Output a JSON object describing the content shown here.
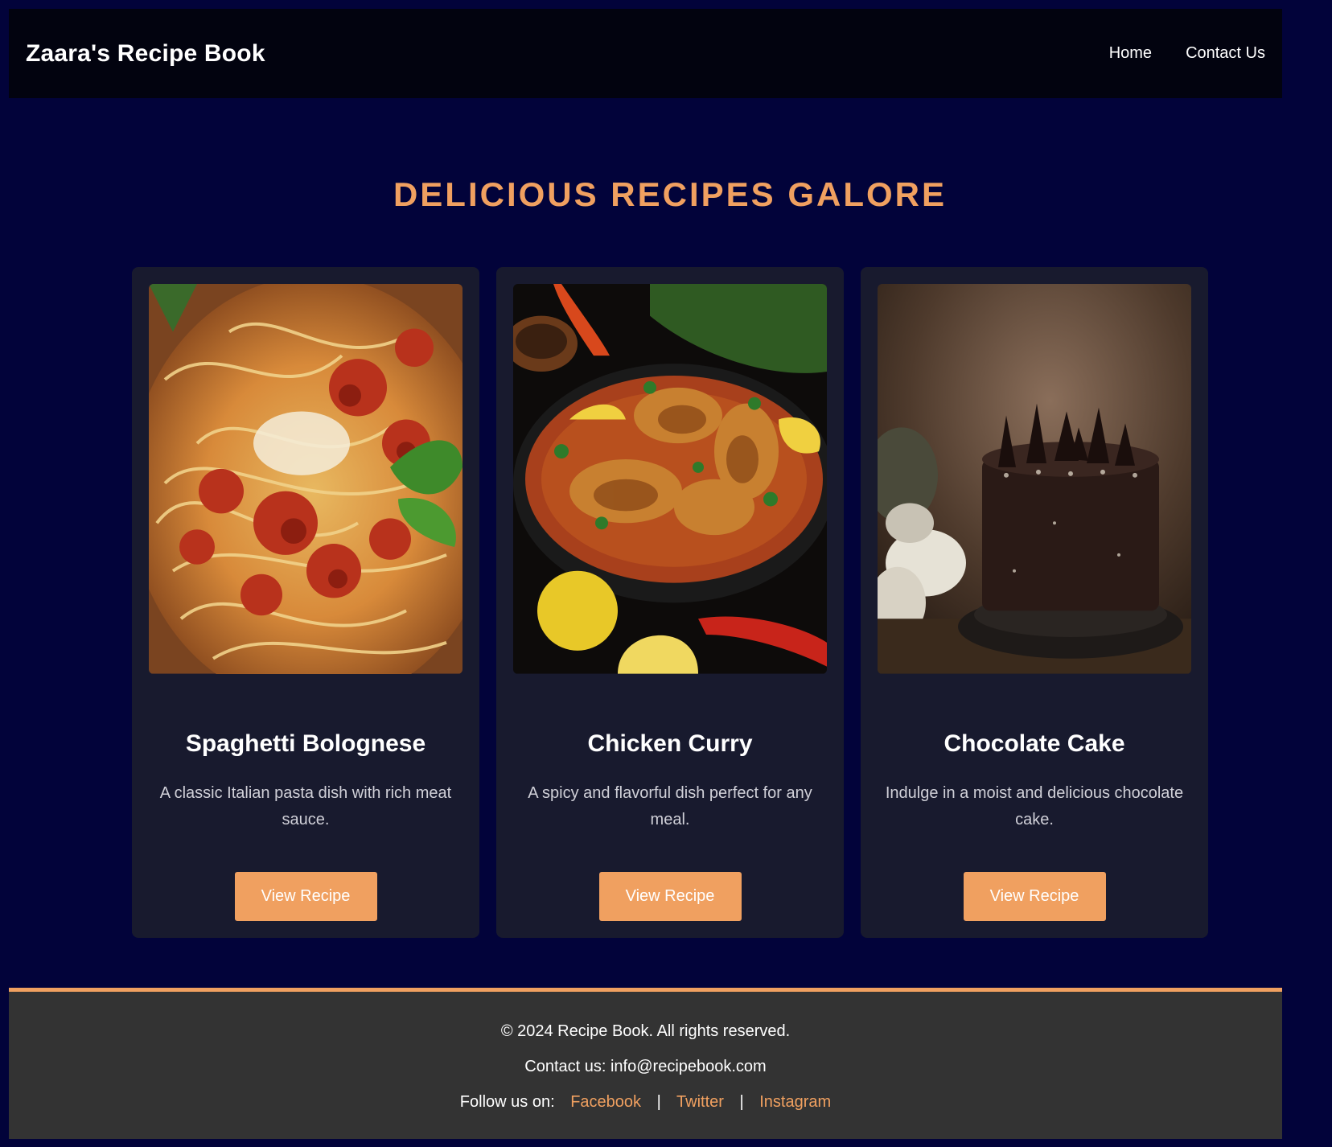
{
  "header": {
    "brand": "Zaara's Recipe Book",
    "nav": [
      {
        "label": "Home"
      },
      {
        "label": "Contact Us"
      }
    ]
  },
  "hero": {
    "title": "DELICIOUS RECIPES GALORE"
  },
  "recipes": [
    {
      "title": "Spaghetti Bolognese",
      "description": "A classic Italian pasta dish with rich meat sauce.",
      "button": "View Recipe",
      "image": "spaghetti-photo"
    },
    {
      "title": "Chicken Curry",
      "description": "A spicy and flavorful dish perfect for any meal.",
      "button": "View Recipe",
      "image": "curry-photo"
    },
    {
      "title": "Chocolate Cake",
      "description": "Indulge in a moist and delicious chocolate cake.",
      "button": "View Recipe",
      "image": "cake-photo"
    }
  ],
  "footer": {
    "copyright": "© 2024 Recipe Book. All rights reserved.",
    "contact": "Contact us: info@recipebook.com",
    "follow_label": "Follow us on:",
    "social": [
      {
        "label": "Facebook"
      },
      {
        "label": "Twitter"
      },
      {
        "label": "Instagram"
      }
    ],
    "separator": "|"
  },
  "colors": {
    "background": "#02033a",
    "navbar": "#02030f",
    "accent": "#f0a060",
    "card": "#181a2e",
    "footer": "#333333"
  }
}
